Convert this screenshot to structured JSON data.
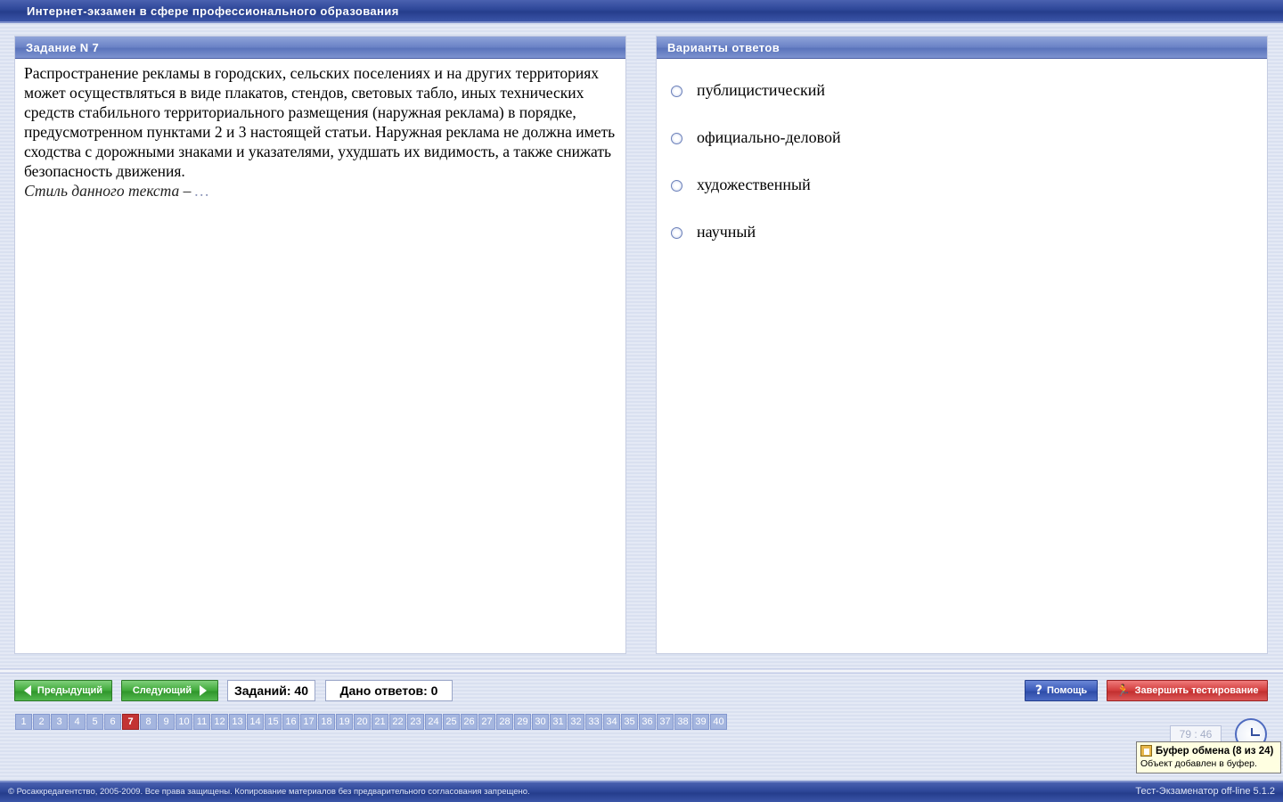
{
  "window": {
    "title": "Интернет-экзамен в сфере профессионального образования"
  },
  "task": {
    "header": "Задание N 7",
    "text": "Распространение рекламы в городских, сельских поселениях и на других территориях может осуществляться в виде плакатов, стендов, световых табло, иных технических средств стабильного территориального размещения (наружная реклама) в порядке, предусмотренном пунктами 2 и 3 настоящей статьи. Наружная реклама не должна иметь сходства с дорожными знаками и указателями, ухудшать их видимость, а также снижать безопасность движения.",
    "prompt": "Стиль данного текста – ",
    "prompt_ellipsis": "…"
  },
  "answers": {
    "header": "Варианты ответов",
    "options": [
      {
        "label": "публицистический"
      },
      {
        "label": "официально-деловой"
      },
      {
        "label": "художественный"
      },
      {
        "label": "научный"
      }
    ]
  },
  "toolbar": {
    "prev_label": "Предыдущий",
    "next_label": "Следующий",
    "total_tasks": "Заданий: 40",
    "answers_given": "Дано ответов: 0",
    "help_label": "Помощь",
    "finish_label": "Завершить тестирование"
  },
  "navigation": {
    "active": 7,
    "items": [
      "1",
      "2",
      "3",
      "4",
      "5",
      "6",
      "7",
      "8",
      "9",
      "10",
      "11",
      "12",
      "13",
      "14",
      "15",
      "16",
      "17",
      "18",
      "19",
      "20",
      "21",
      "22",
      "23",
      "24",
      "25",
      "26",
      "27",
      "28",
      "29",
      "30",
      "31",
      "32",
      "33",
      "34",
      "35",
      "36",
      "37",
      "38",
      "39",
      "40"
    ]
  },
  "timer": {
    "value": "79 : 46"
  },
  "tooltip": {
    "title": "Буфер обмена (8 из 24)",
    "body": "Объект добавлен в буфер."
  },
  "footer": {
    "copyright": "© Росаккредагентство, 2005-2009. Все права защищены. Копирование материалов без предварительного согласования запрещено.",
    "version": "Тест-Экзаменатор off-line 5.1.2"
  },
  "colors": {
    "accent_blue": "#2d4698",
    "active_nav": "#c33333",
    "button_green": "#3fa93a",
    "button_red": "#d23c3c"
  }
}
